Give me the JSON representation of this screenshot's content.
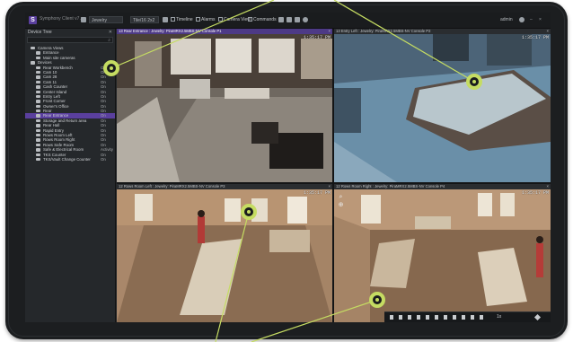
{
  "app": {
    "title": "Symphony Client v7.x",
    "logo_letter": "S",
    "accent_color": "#5a3f9e",
    "callout_color": "#c5dc62"
  },
  "toolbar": {
    "server_select": "Jewelry",
    "layout_select": "Tile/16 2x2",
    "timeline_label": "Timeline",
    "alarms_label": "Alarms",
    "camera_view_label": "Camera View",
    "commands_label": "Commands",
    "user_label": "admin"
  },
  "sidebar": {
    "header": "Device Tree",
    "search_placeholder": "",
    "items": [
      {
        "label": "Camera Views",
        "status": "",
        "indent": 1
      },
      {
        "label": "Entrance",
        "status": "",
        "indent": 2
      },
      {
        "label": "Main site cameras",
        "status": "",
        "indent": 2
      },
      {
        "label": "Devices",
        "status": "",
        "indent": 1
      },
      {
        "label": "Rear Workbench",
        "status": "On",
        "indent": 2
      },
      {
        "label": "Cam 10",
        "status": "On",
        "indent": 2
      },
      {
        "label": "Cam 28",
        "status": "On",
        "indent": 2
      },
      {
        "label": "Cam 11",
        "status": "On",
        "indent": 2
      },
      {
        "label": "Cash Counter",
        "status": "On",
        "indent": 2
      },
      {
        "label": "Center Island",
        "status": "On",
        "indent": 2
      },
      {
        "label": "Entry Left",
        "status": "On",
        "indent": 2
      },
      {
        "label": "Front Corner",
        "status": "On",
        "indent": 2
      },
      {
        "label": "Owner's Office",
        "status": "On",
        "indent": 2
      },
      {
        "label": "Rear",
        "status": "On",
        "indent": 2
      },
      {
        "label": "Rear Entrance",
        "status": "On",
        "indent": 2,
        "selected": true
      },
      {
        "label": "Storage and Return area",
        "status": "On",
        "indent": 2
      },
      {
        "label": "Rear Hall",
        "status": "On",
        "indent": 2
      },
      {
        "label": "Rapid Entry",
        "status": "On",
        "indent": 2
      },
      {
        "label": "Rows Room Left",
        "status": "On",
        "indent": 2
      },
      {
        "label": "Rows Room Right",
        "status": "On",
        "indent": 2
      },
      {
        "label": "Rows Safe Room",
        "status": "On",
        "indent": 2
      },
      {
        "label": "Safe & Electrical Room",
        "status": "Activity",
        "indent": 2
      },
      {
        "label": "TKS Counter",
        "status": "On",
        "indent": 2
      },
      {
        "label": "TKS/Vault Change Counter",
        "status": "On",
        "indent": 2
      }
    ]
  },
  "tiles": [
    {
      "title": "13 Rear Entrance : Jewelry: PiraMRX2.5MBS-NV Console P1",
      "timestamp": "1:35:17 PM",
      "active": true
    },
    {
      "title": "13 Entry Left : Jewelry: PiraMRX2.5MBS-NV Console P2",
      "timestamp": "1:35:17 PM",
      "active": false
    },
    {
      "title": "12 Rows Room Left : Jewelry: PiraMRX2.5MBS-NV Console P3",
      "timestamp": "1:35:17 PM",
      "active": false
    },
    {
      "title": "12 Rows Room Right : Jewelry: PiraMRX2.5MBS-NV Console P4",
      "timestamp": "1:35:17 PM",
      "active": false
    }
  ],
  "playback": {
    "speed": "1x"
  }
}
